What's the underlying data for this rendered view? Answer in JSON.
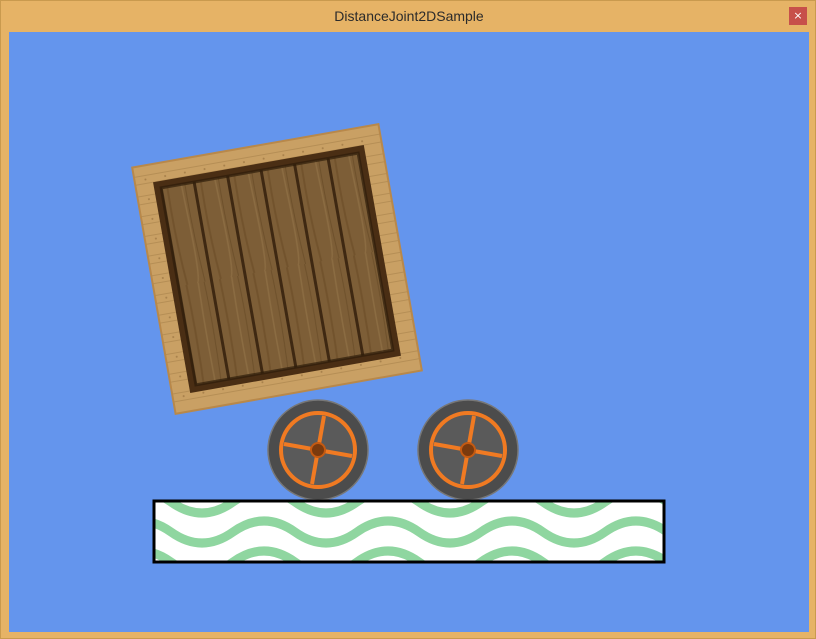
{
  "window": {
    "title": "DistanceJoint2DSample",
    "close_glyph": "×"
  },
  "scene": {
    "background_color": "#6495ed",
    "objects": [
      {
        "kind": "crate",
        "name": "wooden-crate"
      },
      {
        "kind": "wheel",
        "name": "wheel-left"
      },
      {
        "kind": "wheel",
        "name": "wheel-right"
      },
      {
        "kind": "ground",
        "name": "ground-platform"
      }
    ],
    "colors": {
      "crate_frame": "#c79b5a",
      "crate_planks": "#7a5a34",
      "wheel_tire": "#4a4a4a",
      "wheel_rim": "#f07a22",
      "ground_fill": "#ffffff",
      "ground_wave": "#8fd6a0",
      "ground_border": "#000000"
    }
  }
}
